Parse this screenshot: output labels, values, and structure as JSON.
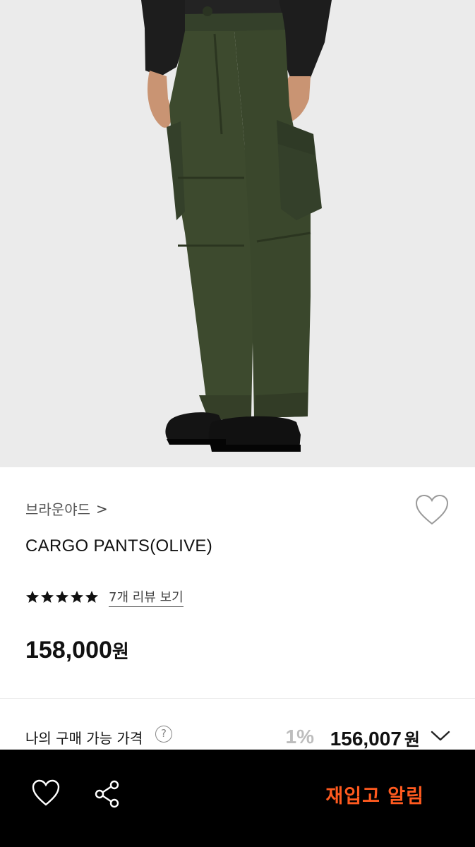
{
  "brand": {
    "name": "브라운야드",
    "chevron": ">"
  },
  "product": {
    "name": "CARGO PANTS(OLIVE)"
  },
  "rating": {
    "stars": 5,
    "review_link": "7개 리뷰 보기"
  },
  "price": {
    "amount": "158,000",
    "unit": "원"
  },
  "my_price": {
    "label": "나의 구매 가능 가격",
    "help": "?",
    "discount": "1%",
    "amount": "156,007",
    "unit": "원"
  },
  "bottom_bar": {
    "restock_label": "재입고 알림"
  },
  "colors": {
    "accent": "#ff5a1f",
    "pants": "#3d4a2e",
    "background": "#ebebeb"
  },
  "icons": [
    "heart-icon",
    "share-icon",
    "chevron-down-icon",
    "star-icon",
    "help-icon"
  ]
}
